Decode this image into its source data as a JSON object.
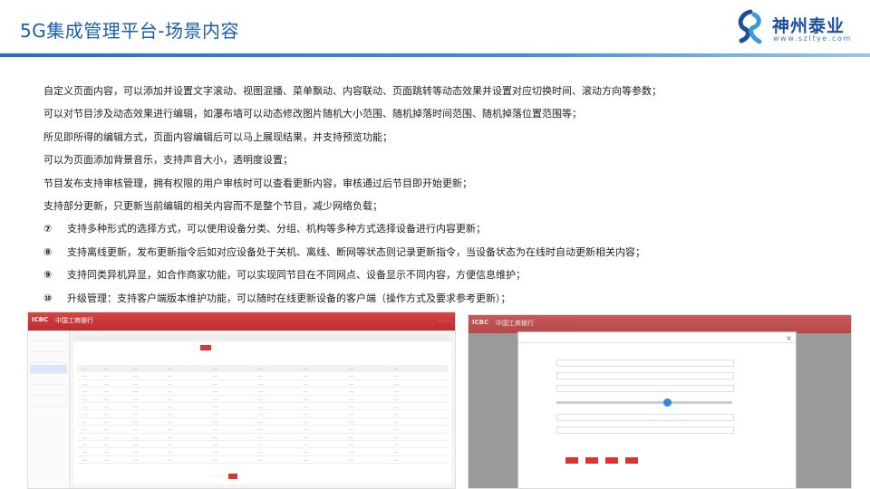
{
  "header": {
    "title": "5G集成管理平台-场景内容",
    "logo_name": "神州泰业",
    "logo_url": "www.szltye.com"
  },
  "features": [
    {
      "num": "",
      "text": "自定义页面内容，可以添加并设置文字滚动、视图混播、菜单飘动、内容联动、页面跳转等动态效果并设置对应切换时间、滚动方向等参数；"
    },
    {
      "num": "",
      "text": "可以对节目涉及动态效果进行编辑，如瀑布墙可以动态修改图片随机大小范围、随机掉落时间范围、随机掉落位置范围等；"
    },
    {
      "num": "",
      "text": "所见即所得的编辑方式，页面内容编辑后可以马上展现结果，并支持预览功能；"
    },
    {
      "num": "",
      "text": "可以为页面添加背景音乐，支持声音大小，透明度设置；"
    },
    {
      "num": "",
      "text": "节目发布支持审核管理，拥有权限的用户审核时可以查看更新内容，审核通过后节目即开始更新；"
    },
    {
      "num": "",
      "text": "支持部分更新，只更新当前编辑的相关内容而不是整个节目，减少网络负载；"
    },
    {
      "num": "⑦",
      "text": "支持多种形式的选择方式，可以使用设备分类、分组、机构等多种方式选择设备进行内容更新；"
    },
    {
      "num": "⑧",
      "text": "支持离线更新，发布更新指令后如对应设备处于关机、离线、断网等状态则记录更新指令，当设备状态为在线时自动更新相关内容；"
    },
    {
      "num": "⑨",
      "text": "支持同类异机异显，如合作商家功能，可以实现同节目在不同网点、设备显示不同内容，方便信息维护；"
    },
    {
      "num": "⑩",
      "text": "升级管理：支持客户端版本维护功能，可以随时在线更新设备的客户端（操作方式及要求参考更新）；"
    }
  ],
  "screenshot_left": {
    "brand": "ICBC",
    "brand_cn": "中国工商银行"
  },
  "screenshot_right": {
    "brand": "ICBC",
    "brand_cn": "中国工商银行"
  },
  "colors": {
    "title_blue": "#1a5fb4",
    "icbc_red": "#c93234",
    "link_green": "#2a9d2a"
  }
}
